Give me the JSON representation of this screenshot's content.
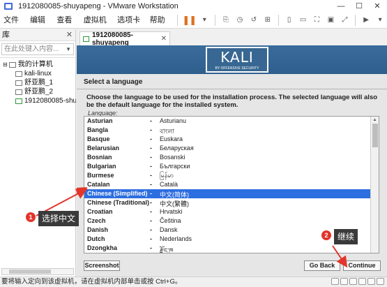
{
  "window": {
    "title": "1912080085-shuyapeng - VMware Workstation",
    "controls": [
      "—",
      "☐",
      "✕"
    ]
  },
  "menu": {
    "items": [
      "文件(F)",
      "编辑(E)",
      "查看(V)",
      "虚拟机(M)",
      "选项卡(T)",
      "帮助(H)"
    ]
  },
  "library": {
    "title": "库",
    "search_placeholder": "在此处键入内容...",
    "tree": [
      {
        "label": "我的计算机",
        "indent": 0
      },
      {
        "label": "kali-linux",
        "indent": 1
      },
      {
        "label": "舒亚鹏_1",
        "indent": 1
      },
      {
        "label": "舒亚鹏_2",
        "indent": 1
      },
      {
        "label": "1912080085-shu",
        "indent": 1,
        "running": true
      }
    ]
  },
  "vm_tab": {
    "label": "1912080085-shuyapeng"
  },
  "banner": {
    "logo_text": "KALI",
    "logo_sub": "BY OFFENSIVE SECURITY"
  },
  "installer": {
    "section_title": "Select a language",
    "description": "Choose the language to be used for the installation process. The selected language will also be the default language for the installed system.",
    "list_label": "Language:",
    "languages": [
      {
        "en": "Asturian",
        "native": "Asturianu"
      },
      {
        "en": "Bangla",
        "native": "বাংলা"
      },
      {
        "en": "Basque",
        "native": "Euskara"
      },
      {
        "en": "Belarusian",
        "native": "Беларуская"
      },
      {
        "en": "Bosnian",
        "native": "Bosanski"
      },
      {
        "en": "Bulgarian",
        "native": "Български"
      },
      {
        "en": "Burmese",
        "native": "မြန်မာ"
      },
      {
        "en": "Catalan",
        "native": "Català"
      },
      {
        "en": "Chinese (Simplified)",
        "native": "中文(简体)",
        "selected": true
      },
      {
        "en": "Chinese (Traditional)",
        "native": "中文(繁體)"
      },
      {
        "en": "Croatian",
        "native": "Hrvatski"
      },
      {
        "en": "Czech",
        "native": "Čeština"
      },
      {
        "en": "Danish",
        "native": "Dansk"
      },
      {
        "en": "Dutch",
        "native": "Nederlands"
      },
      {
        "en": "Dzongkha",
        "native": "རྫོང་ཁ"
      }
    ],
    "dash": "-",
    "screenshot_button": "Screenshot",
    "goback_button": "Go Back",
    "continue_button": "Continue"
  },
  "annotations": [
    {
      "number": "1",
      "text": "选择中文"
    },
    {
      "number": "2",
      "text": "继续"
    }
  ],
  "status": {
    "text": "要将输入定向到该虚拟机，请在虚拟机内部单击或按 Ctrl+G。"
  },
  "colors": {
    "selection": "#2d6ee0",
    "banner": "#2e5e8c",
    "annotation": "#e2352b"
  }
}
